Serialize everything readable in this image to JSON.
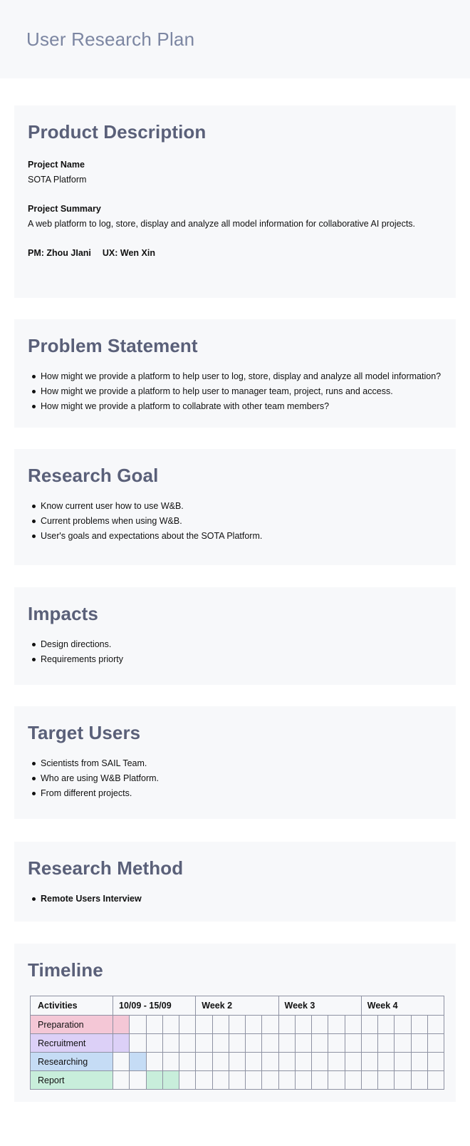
{
  "doc_title": "User Research Plan",
  "product": {
    "heading": "Product Description",
    "name_label": "Project Name",
    "name_value": "SOTA Platform",
    "summary_label": "Project Summary",
    "summary_value": "A web platform to log, store, display and analyze all model information for collaborative AI projects.",
    "pm": "PM: Zhou JIani",
    "ux": "UX: Wen Xin"
  },
  "problem": {
    "heading": "Problem Statement",
    "items": [
      "How might we provide a platform to help user to log, store, display and analyze all model information?",
      "How might we provide a platform to help user to manager team, project, runs and access.",
      "How might we provide a platform to collabrate with other team members?"
    ]
  },
  "goal": {
    "heading": "Research Goal",
    "items": [
      "Know current user how to use W&B.",
      "Current problems when using W&B.",
      "User's goals and expectations about the SOTA Platform."
    ]
  },
  "impacts": {
    "heading": "Impacts",
    "items": [
      "Design directions.",
      "Requirements priorty"
    ]
  },
  "users": {
    "heading": "Target Users",
    "items": [
      "Scientists from SAIL Team.",
      "Who are using W&B Platform.",
      "From different projects."
    ]
  },
  "method": {
    "heading": "Research Method",
    "items": [
      "Remote Users Interview"
    ]
  },
  "timeline": {
    "heading": "Timeline",
    "activities_header": "Activities",
    "weeks": [
      "10/09 - 15/09",
      "Week 2",
      "Week 3",
      "Week 4"
    ],
    "rows": [
      {
        "label": "Preparation",
        "color": "#f4c7d6",
        "filled": [
          0
        ]
      },
      {
        "label": "Recruitment",
        "color": "#dcd0f7",
        "filled": [
          0
        ]
      },
      {
        "label": "Researching",
        "color": "#c5dcf5",
        "filled": [
          1
        ]
      },
      {
        "label": "Report",
        "color": "#c8eedb",
        "filled": [
          2,
          3
        ]
      }
    ],
    "cells_per_week": 5
  }
}
